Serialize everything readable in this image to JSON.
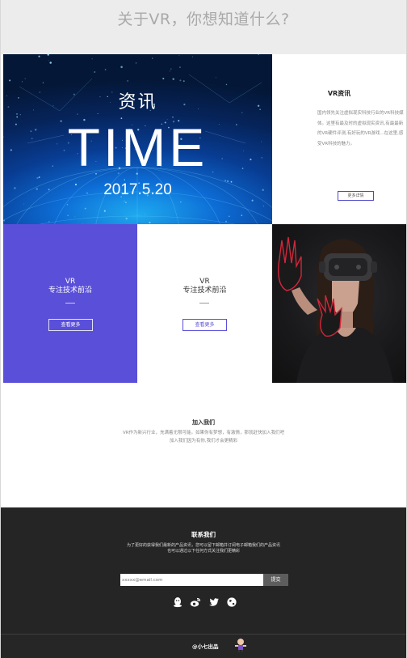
{
  "header": {
    "title": "关于VR，你想知道什么?"
  },
  "hero": {
    "small": "资讯",
    "big": "TIME",
    "date": "2017.5.20"
  },
  "news": {
    "title": "VR资讯",
    "text": "国内领先关注虚拟现实科技行业的VR科技媒体。这里有最及时的虚拟现实资讯,有最最新的VR硬件评测,有好玩的VR游戏...在这里,感受VR科技的魅力。",
    "button": "更多详情"
  },
  "cards": [
    {
      "heading": "VR",
      "sub": "专注技术前沿",
      "button": "查看更多"
    },
    {
      "heading": "VR",
      "sub": "专注技术前沿",
      "button": "查看更多"
    }
  ],
  "join": {
    "title": "加入我们",
    "line1": "VR作为新兴行业，充满着无限可能。如果你有梦想，有激情，那就赶快加入我们吧",
    "line2": "加入我们因为有你,我们才会更精彩"
  },
  "footer": {
    "title": "联系我们",
    "line1": "为了更好的获得我们最新的产品资讯，您可以留下邮箱并订阅电子邮箱我们的产品资讯",
    "line2": "也可以通过以下任何方式关注我们更精彩",
    "email_placeholder": "xxxxx@email.com",
    "submit": "提交",
    "social_icons": [
      "qq-icon",
      "weibo-icon",
      "twitter-icon",
      "globe-icon"
    ],
    "credit": "@小七出品"
  },
  "colors": {
    "accent": "#5a4fd8",
    "footer_bg": "#252525",
    "header_bg": "#ececec"
  }
}
